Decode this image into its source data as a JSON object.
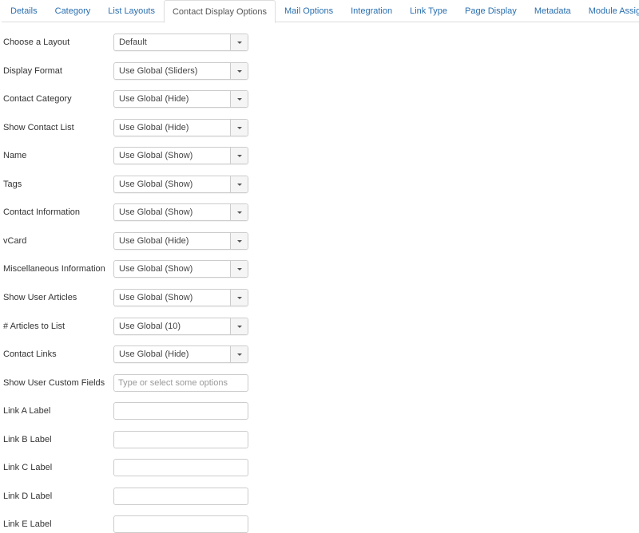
{
  "tabs": [
    "Details",
    "Category",
    "List Layouts",
    "Contact Display Options",
    "Mail Options",
    "Integration",
    "Link Type",
    "Page Display",
    "Metadata",
    "Module Assignment"
  ],
  "active_tab": 3,
  "selects": [
    {
      "label": "Choose a Layout",
      "value": "Default"
    },
    {
      "label": "Display Format",
      "value": "Use Global (Sliders)"
    },
    {
      "label": "Contact Category",
      "value": "Use Global (Hide)"
    },
    {
      "label": "Show Contact List",
      "value": "Use Global (Hide)"
    },
    {
      "label": "Name",
      "value": "Use Global (Show)"
    },
    {
      "label": "Tags",
      "value": "Use Global (Show)"
    },
    {
      "label": "Contact Information",
      "value": "Use Global (Show)"
    },
    {
      "label": "vCard",
      "value": "Use Global (Hide)"
    },
    {
      "label": "Miscellaneous Information",
      "value": "Use Global (Show)"
    },
    {
      "label": "Show User Articles",
      "value": "Use Global (Show)"
    },
    {
      "label": "# Articles to List",
      "value": "Use Global (10)"
    },
    {
      "label": "Contact Links",
      "value": "Use Global (Hide)"
    }
  ],
  "inputs": [
    {
      "label": "Show User Custom Fields",
      "value": "",
      "placeholder": "Type or select some options"
    },
    {
      "label": "Link A Label",
      "value": "",
      "placeholder": ""
    },
    {
      "label": "Link B Label",
      "value": "",
      "placeholder": ""
    },
    {
      "label": "Link C Label",
      "value": "",
      "placeholder": ""
    },
    {
      "label": "Link D Label",
      "value": "",
      "placeholder": ""
    },
    {
      "label": "Link E Label",
      "value": "",
      "placeholder": ""
    }
  ]
}
